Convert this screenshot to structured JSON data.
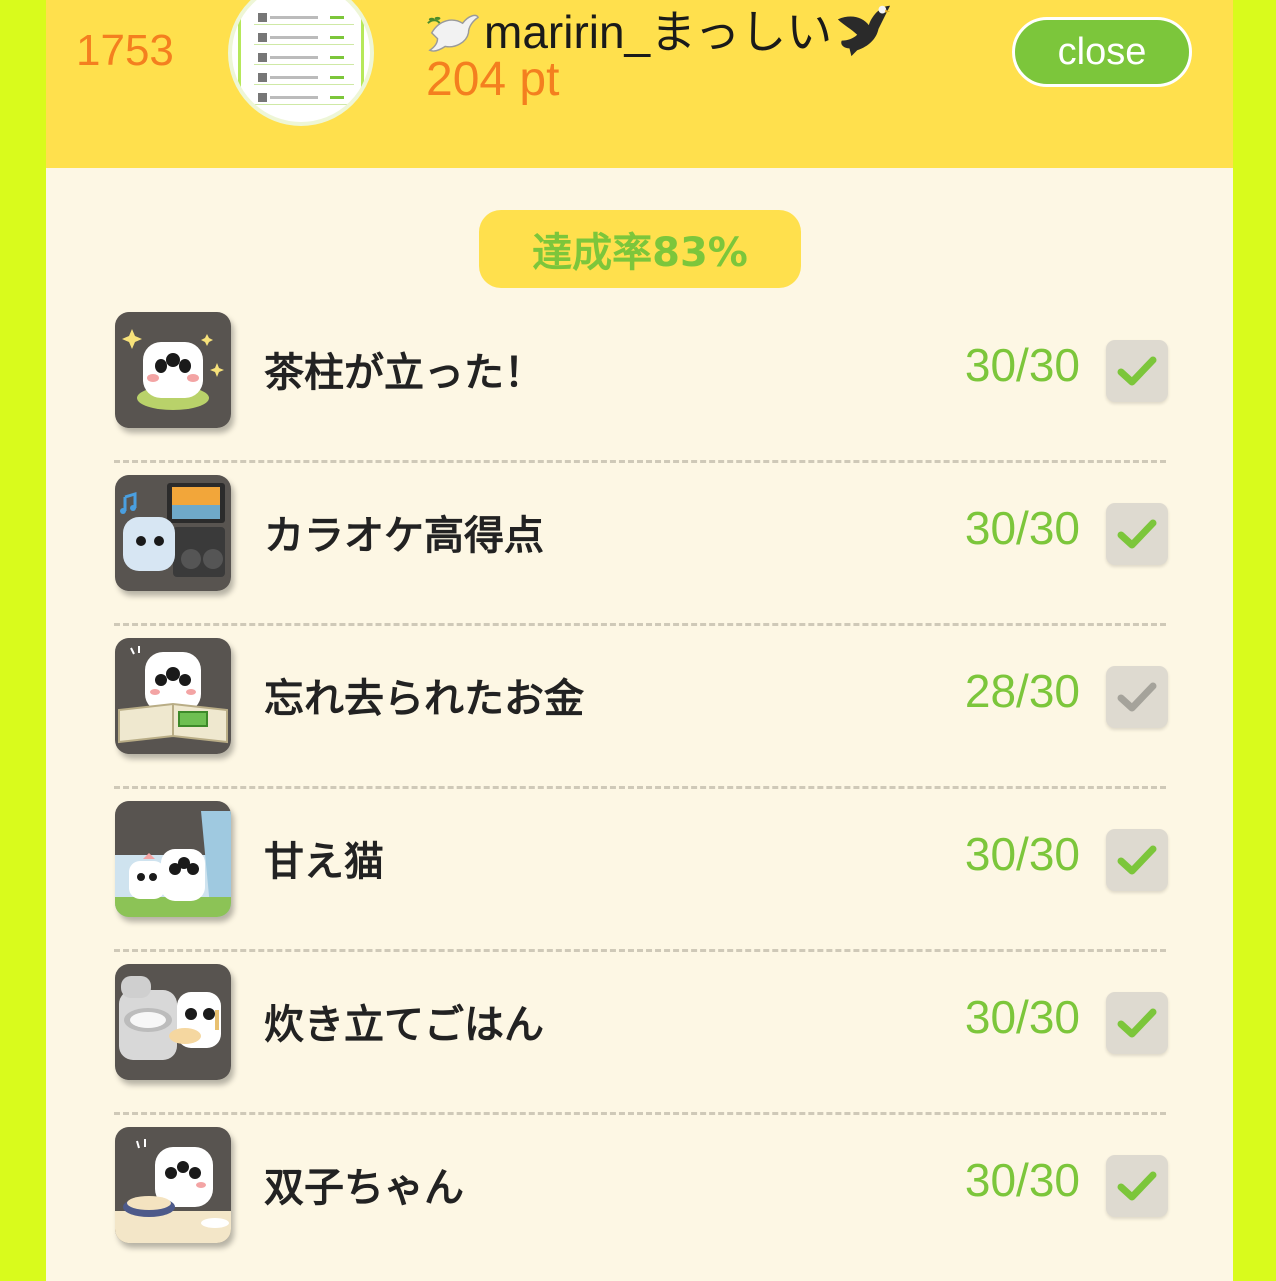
{
  "header": {
    "rank": "1753",
    "username": "maririn_まっしい",
    "points": "204 pt",
    "close_label": "close"
  },
  "achievement_rate": "達成率83%",
  "colors": {
    "background": "#d9fb1c",
    "header": "#ffe04d",
    "accent_green": "#7cc63b",
    "accent_orange": "#f47f1f"
  },
  "items": [
    {
      "title": "茶柱が立った！",
      "score": "30/30",
      "complete": true,
      "icon": "tea-pillar-icon"
    },
    {
      "title": "カラオケ高得点",
      "score": "30/30",
      "complete": true,
      "icon": "karaoke-icon"
    },
    {
      "title": "忘れ去られたお金",
      "score": "28/30",
      "complete": false,
      "icon": "forgotten-money-icon"
    },
    {
      "title": "甘え猫",
      "score": "30/30",
      "complete": true,
      "icon": "cat-icon"
    },
    {
      "title": "炊き立てごはん",
      "score": "30/30",
      "complete": true,
      "icon": "rice-cooker-icon"
    },
    {
      "title": "双子ちゃん",
      "score": "30/30",
      "complete": true,
      "icon": "twins-icon"
    }
  ]
}
